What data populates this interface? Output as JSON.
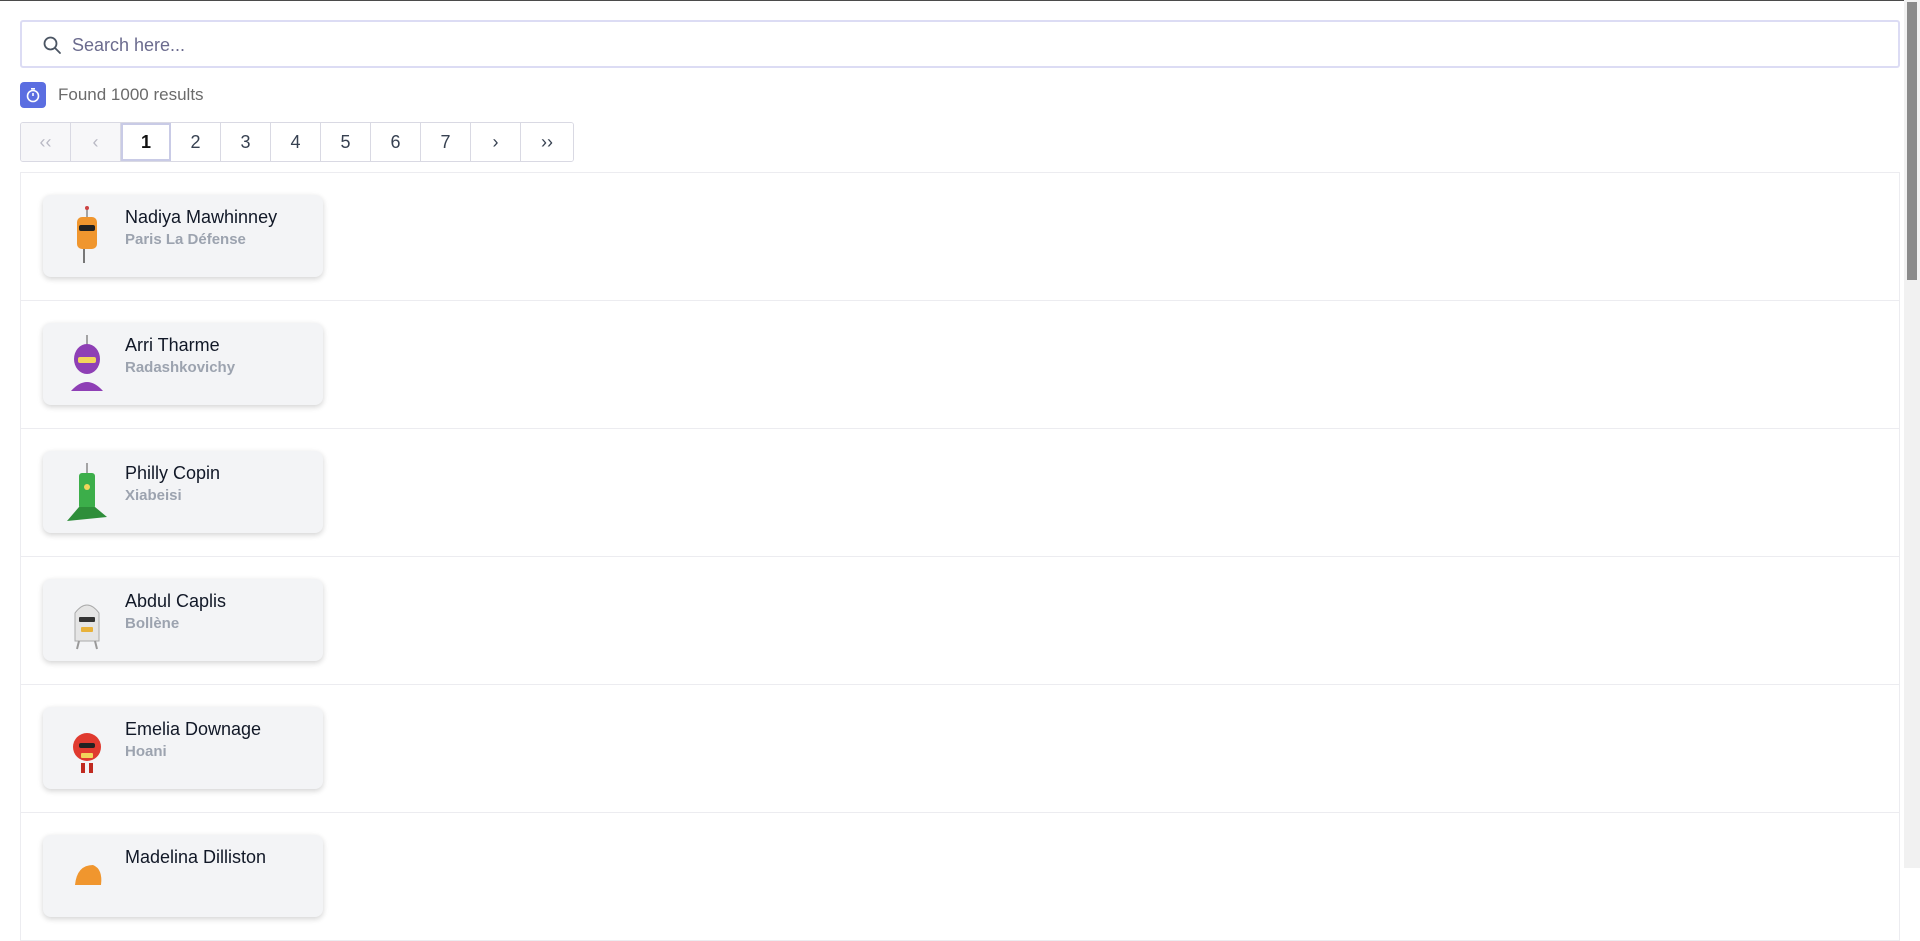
{
  "search": {
    "placeholder": "Search here..."
  },
  "results": {
    "text": "Found 1000 results"
  },
  "pagination": {
    "first": "‹‹",
    "prev": "‹",
    "pages": [
      "1",
      "2",
      "3",
      "4",
      "5",
      "6",
      "7"
    ],
    "active": "1",
    "next": "›",
    "last": "››"
  },
  "people": [
    {
      "name": "Nadiya Mawhinney",
      "city": "Paris La Défense",
      "avatar_color": "#f0962e"
    },
    {
      "name": "Arri Tharme",
      "city": "Radashkovichy",
      "avatar_color": "#8e3fb5"
    },
    {
      "name": "Philly Copin",
      "city": "Xiabeisi",
      "avatar_color": "#3cae4a"
    },
    {
      "name": "Abdul Caplis",
      "city": "Bollène",
      "avatar_color": "#d9d9d9"
    },
    {
      "name": "Emelia Downage",
      "city": "Hoani",
      "avatar_color": "#e03a2f"
    },
    {
      "name": "Madelina Dilliston",
      "city": "",
      "avatar_color": "#f0962e"
    }
  ],
  "colors": {
    "accent": "#5b6ee1"
  }
}
